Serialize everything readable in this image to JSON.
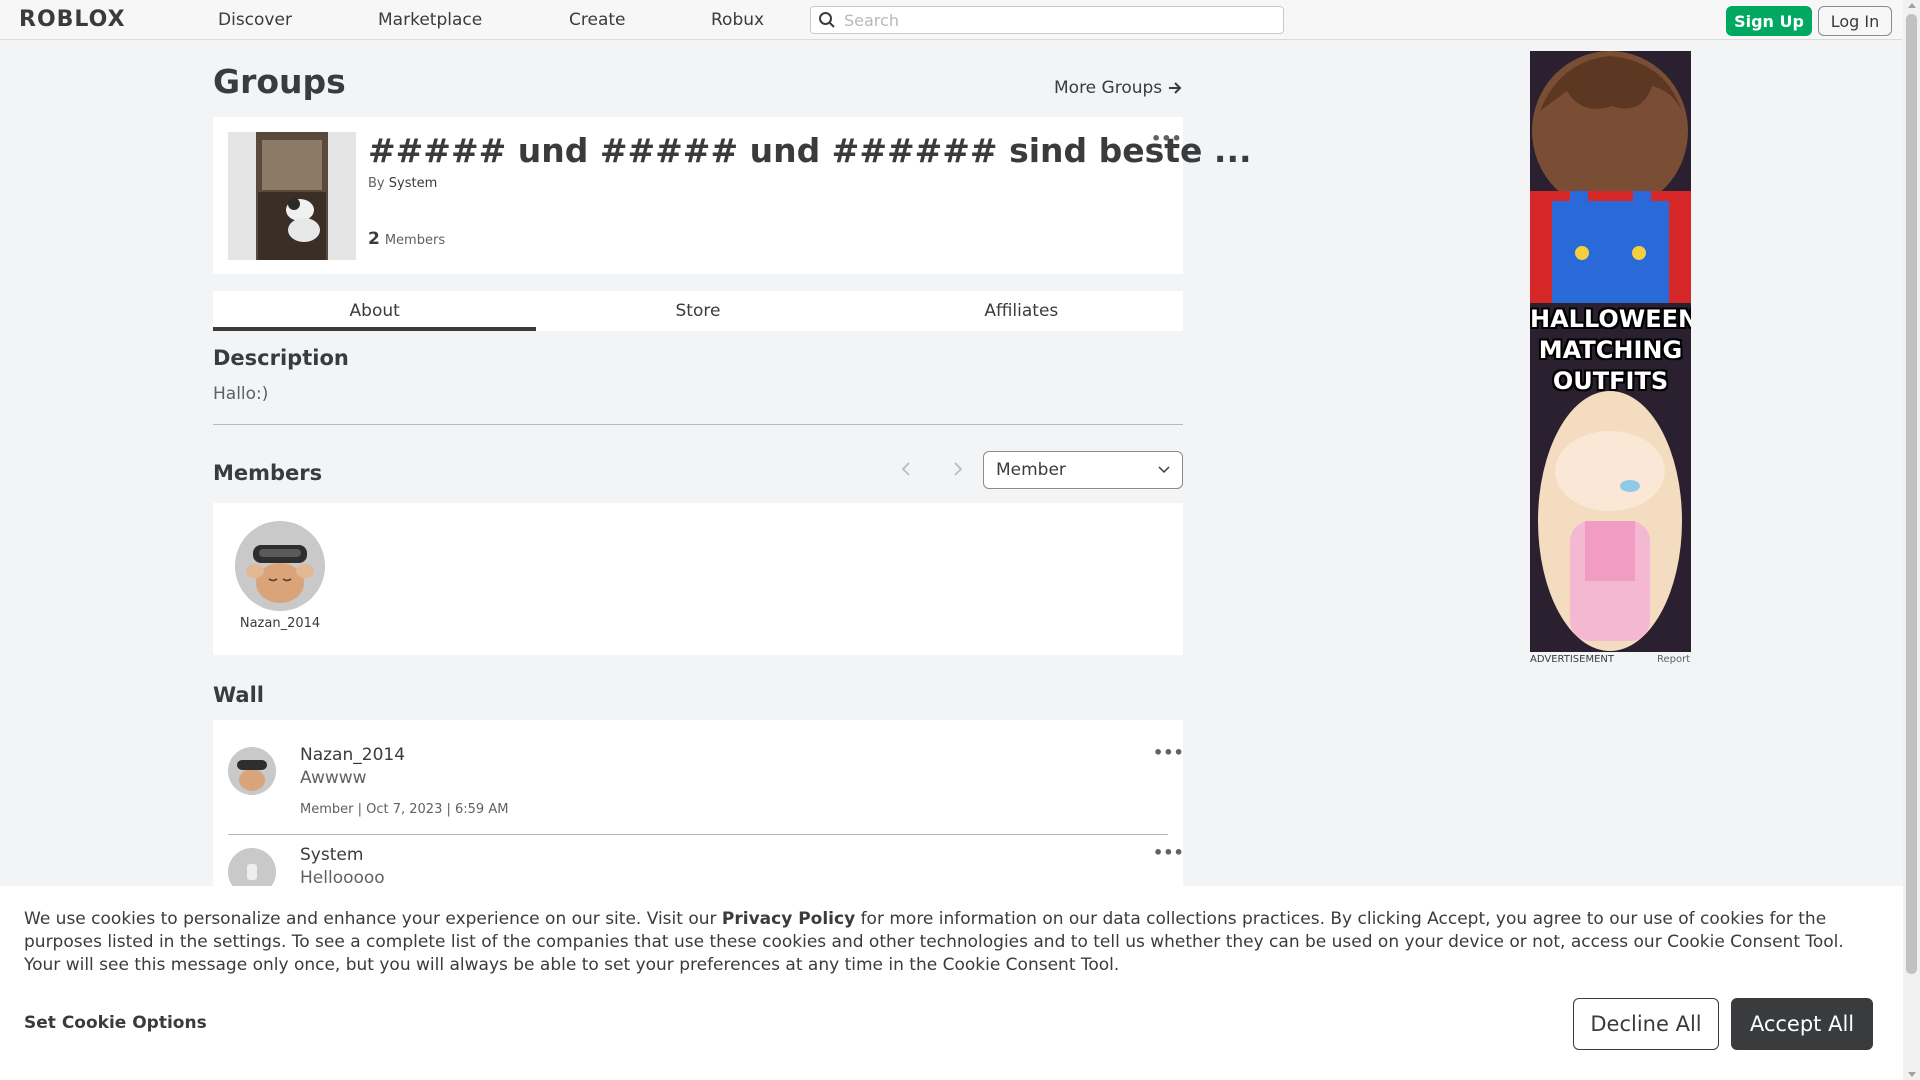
{
  "nav": {
    "logo": "ROBLOX",
    "links": [
      "Discover",
      "Marketplace",
      "Create",
      "Robux"
    ],
    "search_placeholder": "Search",
    "signup": "Sign Up",
    "login": "Log In"
  },
  "page": {
    "title": "Groups",
    "more_groups": "More Groups"
  },
  "group": {
    "name": "##### und ##### und ###### sind beste ...",
    "by_label": "By",
    "owner": "System",
    "member_count": "2",
    "members_label": "Members"
  },
  "tabs": [
    "About",
    "Store",
    "Affiliates"
  ],
  "about": {
    "description_heading": "Description",
    "description": "Hallo:)"
  },
  "members": {
    "heading": "Members",
    "role_selected": "Member",
    "list": [
      {
        "name": "Nazan_2014"
      }
    ]
  },
  "wall": {
    "heading": "Wall",
    "posts": [
      {
        "author": "Nazan_2014",
        "body": "Awwww",
        "meta": "Member | Oct 7, 2023 | 6:59 AM"
      },
      {
        "author": "System",
        "body": "Hellooooo",
        "meta": ""
      }
    ]
  },
  "ad": {
    "text": "HALLOWEEN MATCHING OUTFITS",
    "label": "ADVERTISEMENT",
    "report": "Report"
  },
  "cookie": {
    "text_before": "We use cookies to personalize and enhance your experience on our site. Visit our ",
    "privacy_link": "Privacy Policy",
    "text_after": " for more information on our data collections practices. By clicking Accept, you agree to our use of cookies for the purposes listed in the settings. To see a complete list of the companies that use these cookies and other technologies and to tell us whether they can be used on your device or not, access our Cookie Consent Tool. Your will see this message only once, but you will always be able to set your preferences at any time in the Cookie Consent Tool.",
    "set_options": "Set Cookie Options",
    "decline": "Decline All",
    "accept": "Accept All"
  },
  "colors": {
    "signup_green": "#00a862",
    "text_dark": "#393b3d",
    "page_bg": "#f2f4f5"
  }
}
